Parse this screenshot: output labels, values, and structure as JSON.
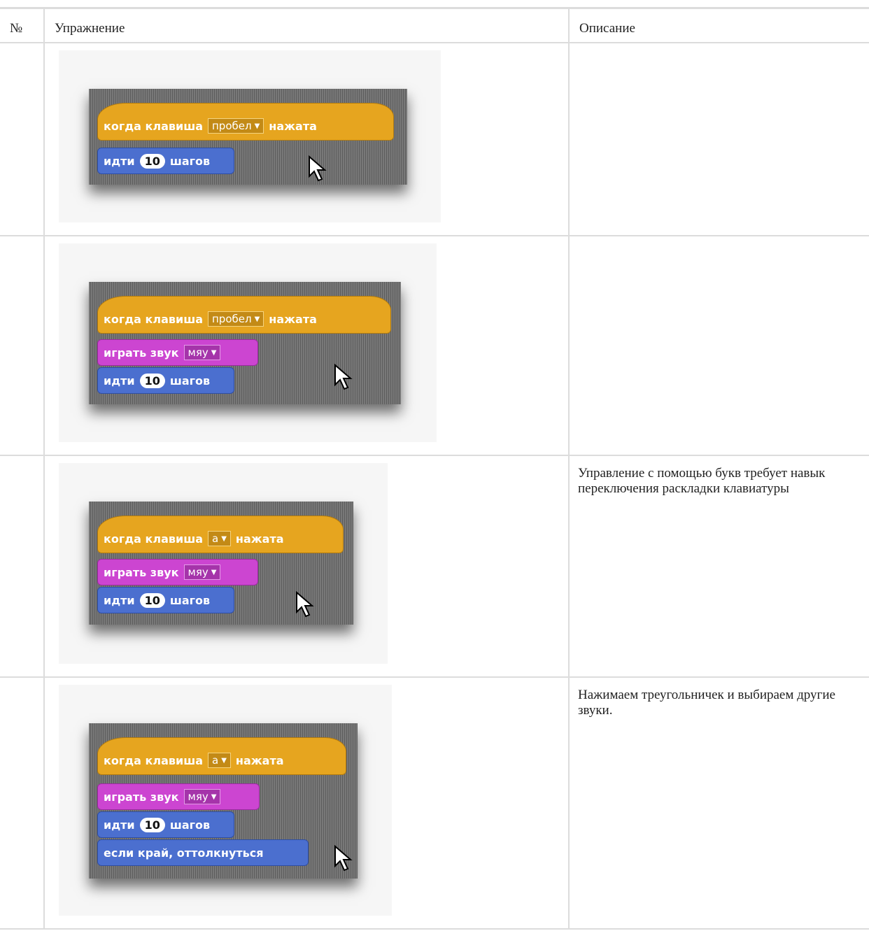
{
  "table": {
    "headers": {
      "num": "№",
      "exercise": "Упражнение",
      "desc": "Описание"
    },
    "rows": [
      {
        "num": "",
        "desc": "",
        "key": "пробел",
        "sound": "",
        "steps_pre": "идти",
        "steps_num": "10",
        "steps_post": "шагов",
        "bounce": ""
      },
      {
        "num": "",
        "desc": "",
        "key": "пробел",
        "sound": "мяу",
        "steps_pre": "идти",
        "steps_num": "10",
        "steps_post": "шагов",
        "bounce": ""
      },
      {
        "num": "",
        "desc": "Управление с помощью букв требует навык переключения раскладки клавиатуры",
        "key": "а",
        "sound": "мяу",
        "steps_pre": "идти",
        "steps_num": "10",
        "steps_post": "шагов",
        "bounce": ""
      },
      {
        "num": "",
        "desc": "Нажимаем треугольничек и выбираем другие звуки.",
        "key": "а",
        "sound": "мяу",
        "steps_pre": "идти",
        "steps_num": "10",
        "steps_post": "шагов",
        "bounce": "если край, оттолкнуться"
      }
    ]
  },
  "blocks": {
    "hat_pre": "когда клавиша",
    "hat_post": "нажата",
    "sound_label": "играть звук"
  },
  "colors": {
    "event": "#e6a51f",
    "sound": "#cc45d1",
    "motion": "#4b6fcf"
  }
}
